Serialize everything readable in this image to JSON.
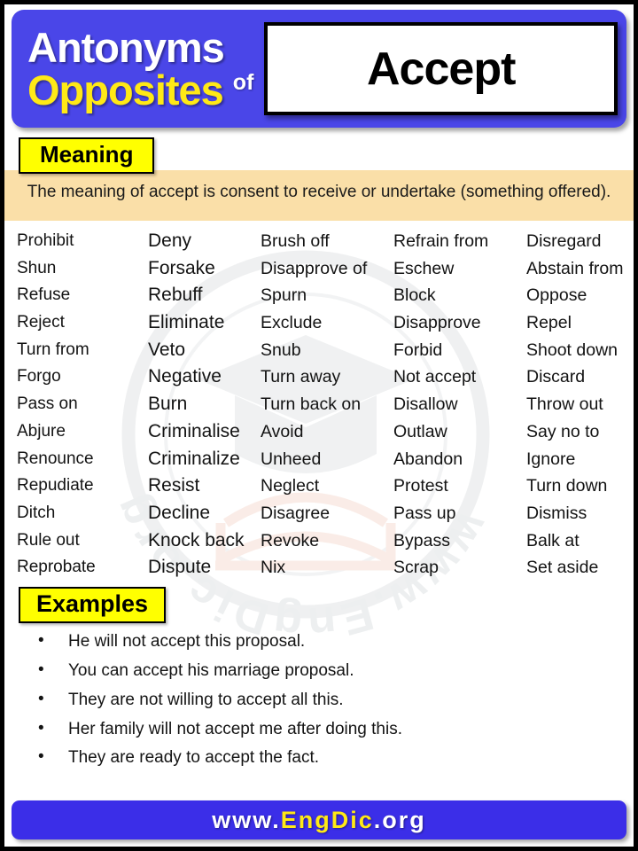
{
  "header": {
    "line1": "Antonyms",
    "line2": "Opposites",
    "connector": "of",
    "word": "Accept",
    "bg_color": "#4a46e8",
    "line1_color": "#ffffff",
    "line2_color": "#ffe916"
  },
  "meaning": {
    "label": "Meaning",
    "text": "The meaning of accept is consent to receive or undertake (something offered).",
    "label_bg": "#ffff00",
    "body_bg": "#fadfa8"
  },
  "columns": [
    {
      "words": [
        "Prohibit",
        "Shun",
        "Refuse",
        "Reject",
        "Turn from",
        "Forgo",
        "Pass on",
        "Abjure",
        "Renounce",
        "Repudiate",
        "Ditch",
        "Rule out",
        "Reprobate"
      ]
    },
    {
      "words": [
        "Deny",
        "Forsake",
        "Rebuff",
        "Eliminate",
        "Veto",
        "Negative",
        "Burn",
        "Criminalise",
        "Criminalize",
        "Resist",
        "Decline",
        "Knock back",
        "Dispute"
      ]
    },
    {
      "words": [
        "Brush off",
        "Disapprove of",
        "Spurn",
        "Exclude",
        "Snub",
        "Turn away",
        "Turn back on",
        "Avoid",
        "Unheed",
        "Neglect",
        "Disagree",
        "Revoke",
        "Nix"
      ]
    },
    {
      "words": [
        "Refrain from",
        "Eschew",
        "Block",
        "Disapprove",
        "Forbid",
        "Not accept",
        "Disallow",
        "Outlaw",
        "Abandon",
        "Protest",
        "Pass up",
        "Bypass",
        "Scrap"
      ]
    },
    {
      "words": [
        "Disregard",
        "Abstain from",
        "Oppose",
        "Repel",
        "Shoot down",
        "Discard",
        "Throw out",
        "Say no to",
        "Ignore",
        "Turn down",
        "Dismiss",
        "Balk at",
        "Set aside"
      ]
    }
  ],
  "examples": {
    "label": "Examples",
    "bullet": "•",
    "items": [
      "He will not accept this proposal.",
      "You can accept his marriage proposal.",
      "They are not willing to accept all this.",
      "Her family will not accept me after doing this.",
      "They are ready to accept the fact."
    ]
  },
  "footer": {
    "prefix": "www.",
    "brand": "EngDic",
    "suffix": ".org",
    "bg_color": "#3b2ee8",
    "brand_color": "#ffe916"
  },
  "watermark": {
    "text": "www.EngDic.org"
  }
}
